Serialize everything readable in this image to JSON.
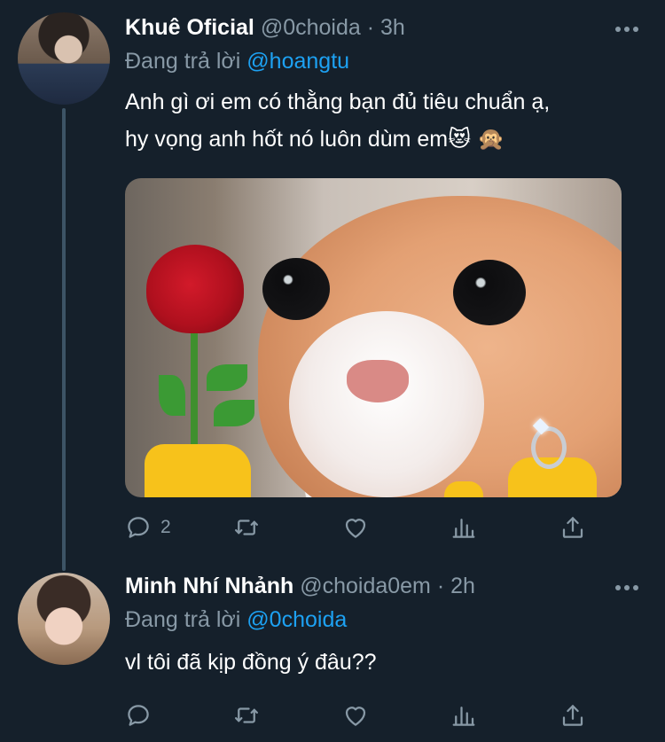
{
  "tweets": [
    {
      "name": "Khuê Oficial",
      "handle": "@0choida",
      "separator": "·",
      "time": "3h",
      "replying_label": "Đang trả lời",
      "replying_to": "@hoangtu",
      "text_line1": "Anh gì ơi em có thằng bạn đủ tiêu chuẩn ạ,",
      "text_line2": "hy vọng anh hốt nó luôn dùm em😻 🙊",
      "reply_count": "2"
    },
    {
      "name": "Minh Nhí Nhảnh",
      "handle": "@choida0em",
      "separator": "·",
      "time": "2h",
      "replying_label": "Đang trả lời",
      "replying_to": "@0choida",
      "text_line1": "vl tôi đã kịp đồng ý đâu??",
      "reply_count": ""
    }
  ],
  "icons": [
    "avatar",
    "more-icon",
    "reply-icon",
    "retweet-icon",
    "like-icon",
    "stats-icon",
    "share-icon"
  ],
  "colors": {
    "background": "#15202b",
    "muted": "#8899a6",
    "link": "#1da1f2",
    "text": "#ffffff"
  }
}
